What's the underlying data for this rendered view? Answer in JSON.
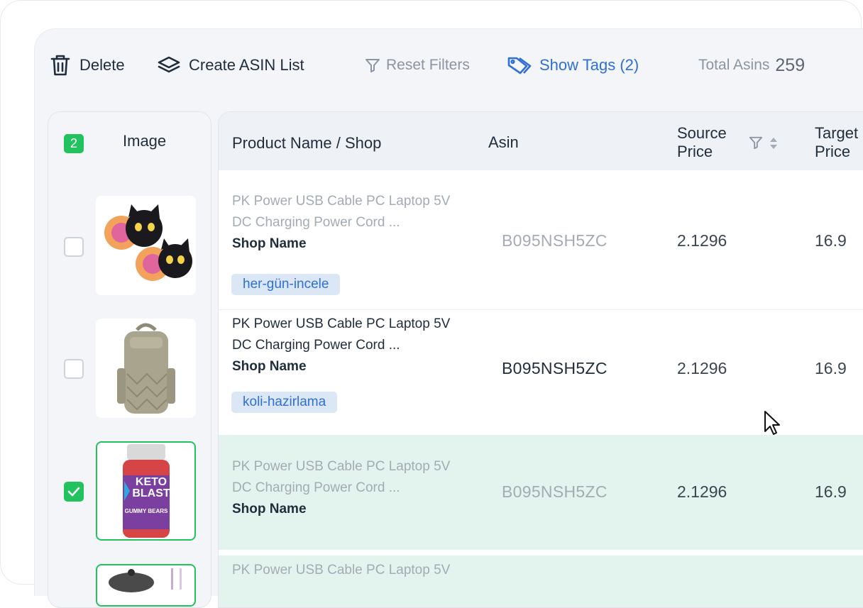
{
  "toolbar": {
    "delete_label": "Delete",
    "create_label": "Create ASIN List",
    "reset_label": "Reset Filters",
    "tags_label": "Show Tags (2)",
    "total_label": "Total Asins",
    "total_value": "259"
  },
  "left_column": {
    "selected_count": "2",
    "image_header": "Image"
  },
  "table": {
    "columns": {
      "product": "Product Name / Shop",
      "asin": "Asin",
      "source_price_line1": "Source",
      "source_price_line2": "Price",
      "target_price_line1": "Target",
      "target_price_line2": "Price"
    },
    "rows": [
      {
        "name_line1": "PK Power USB Cable PC Laptop 5V",
        "name_line2": "DC Charging Power Cord ...",
        "shop": "Shop Name",
        "tag": "her-gün-incele",
        "asin": "B095NSH5ZC",
        "source_price": "2.1296",
        "target_price": "16.9",
        "checked": false,
        "image_icon": "cat-cushion-image"
      },
      {
        "name_line1": "PK Power USB Cable PC Laptop 5V",
        "name_line2": "DC Charging Power Cord ...",
        "shop": "Shop Name",
        "tag": "koli-hazirlama",
        "asin": "B095NSH5ZC",
        "source_price": "2.1296",
        "target_price": "16.9",
        "checked": false,
        "image_icon": "backpack-image"
      },
      {
        "name_line1": "PK Power USB Cable PC Laptop 5V",
        "name_line2": "DC Charging Power Cord ...",
        "shop": "Shop Name",
        "asin": "B095NSH5ZC",
        "source_price": "2.1296",
        "target_price": "16.9",
        "checked": true,
        "image_icon": "supplement-bottle-image",
        "image_text_1": "KETO",
        "image_text_2": "BLAST",
        "image_text_3": "GUMMY BEARS"
      },
      {
        "name_line1": "PK Power USB Cable PC Laptop 5V",
        "checked": true,
        "image_icon": "cookware-image"
      }
    ]
  },
  "colors": {
    "accent_green": "#22c35e",
    "accent_blue": "#2f6fd6",
    "selected_row": "#e3f4ee",
    "tag_bg": "#dce7f6"
  }
}
